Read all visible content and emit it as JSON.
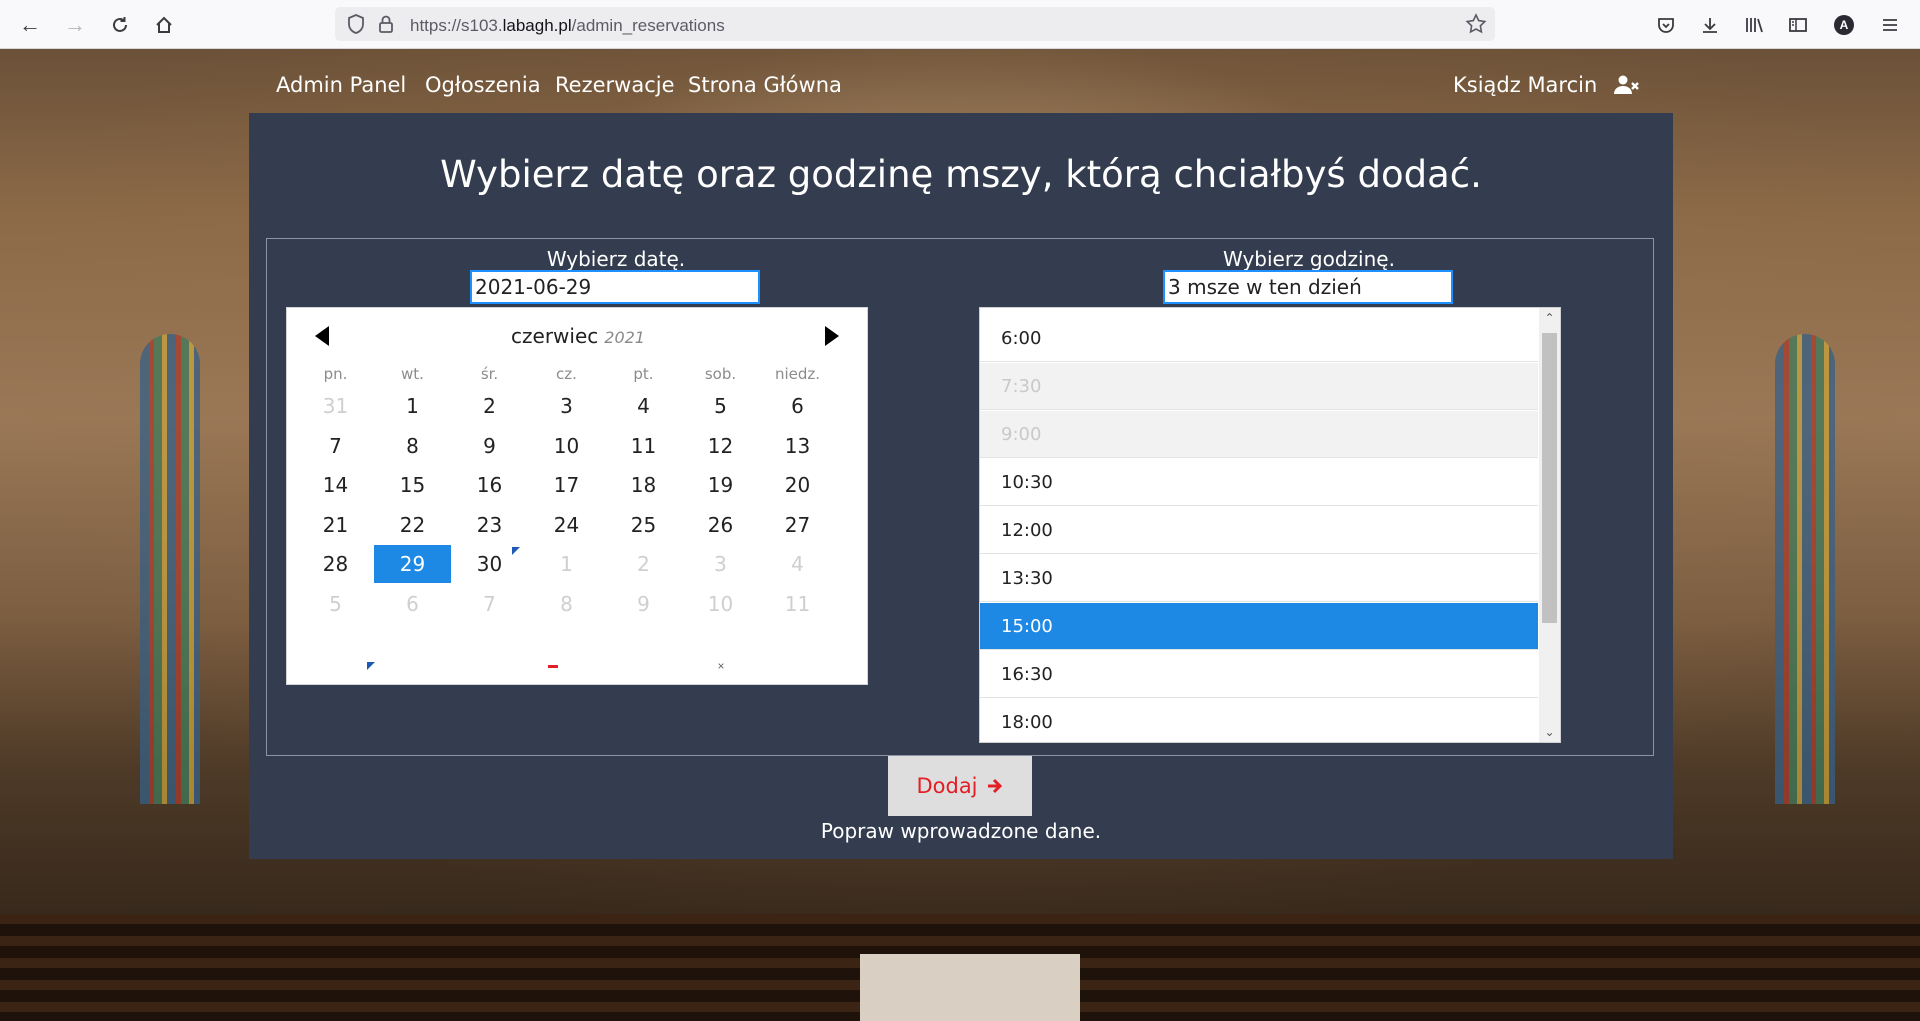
{
  "browser": {
    "url_prefix": "https://s103.",
    "url_domain": "labagh.pl",
    "url_path": "/admin_reservations",
    "profile_initial": "A"
  },
  "nav": {
    "links": [
      "Admin Panel",
      "Ogłoszenia",
      "Rezerwacje",
      "Strona Główna"
    ],
    "user_name": "Ksiądz Marcin"
  },
  "main": {
    "title": "Wybierz datę oraz godzinę mszy, którą chciałbyś dodać.",
    "date_label": "Wybierz datę.",
    "date_value": "2021-06-29",
    "time_label": "Wybierz godzinę.",
    "time_value": "3 msze w ten dzień",
    "submit_label": "Dodaj",
    "status_message": "Popraw wprowadzone dane."
  },
  "calendar": {
    "month": "czerwiec",
    "year": "2021",
    "weekdays": [
      "pn.",
      "wt.",
      "śr.",
      "cz.",
      "pt.",
      "sob.",
      "niedz."
    ],
    "weeks": [
      [
        "31",
        "1",
        "2",
        "3",
        "4",
        "5",
        "6"
      ],
      [
        "7",
        "8",
        "9",
        "10",
        "11",
        "12",
        "13"
      ],
      [
        "14",
        "15",
        "16",
        "17",
        "18",
        "19",
        "20"
      ],
      [
        "21",
        "22",
        "23",
        "24",
        "25",
        "26",
        "27"
      ],
      [
        "28",
        "29",
        "30",
        "1",
        "2",
        "3",
        "4"
      ],
      [
        "5",
        "6",
        "7",
        "8",
        "9",
        "10",
        "11"
      ]
    ],
    "selected_day": "29"
  },
  "times": [
    {
      "label": "6:00",
      "state": "normal"
    },
    {
      "label": "7:30",
      "state": "disabled"
    },
    {
      "label": "9:00",
      "state": "disabled"
    },
    {
      "label": "10:30",
      "state": "normal"
    },
    {
      "label": "12:00",
      "state": "normal"
    },
    {
      "label": "13:30",
      "state": "normal"
    },
    {
      "label": "15:00",
      "state": "selected"
    },
    {
      "label": "16:30",
      "state": "normal"
    },
    {
      "label": "18:00",
      "state": "normal"
    }
  ],
  "colors": {
    "accent": "#1e88e5",
    "panel": "#333d4f",
    "submit_text": "#e31e24"
  }
}
